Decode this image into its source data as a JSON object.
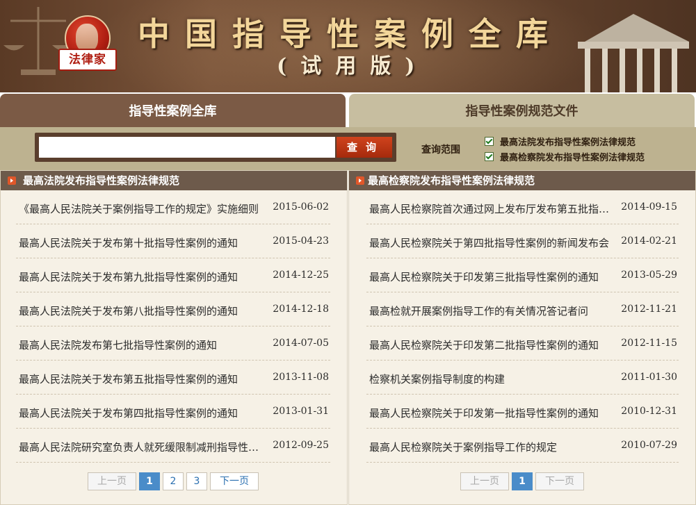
{
  "banner": {
    "logo_text": "法律家",
    "title": "中国指导性案例全库",
    "subtitle": "(试用版)"
  },
  "tabs": [
    {
      "label": "指导性案例全库",
      "active": true
    },
    {
      "label": "指导性案例规范文件",
      "active": false
    }
  ],
  "search": {
    "value": "",
    "button_label": "查询",
    "range_label": "查询范围",
    "options": [
      {
        "label": "最高法院发布指导性案例法律规范",
        "checked": true
      },
      {
        "label": "最高检察院发布指导性案例法律规范",
        "checked": true
      }
    ]
  },
  "colors": {
    "active_tab": "#7b5a45",
    "inactive_tab": "#c7bea0",
    "search_button": "#c23a17",
    "panel_header": "#6d5a4b",
    "pager_current": "#4a8cc9"
  },
  "left_panel": {
    "header": "最高法院发布指导性案例法律规范",
    "items": [
      {
        "title": "《最高人民法院关于案例指导工作的规定》实施细则",
        "date": "2015-06-02"
      },
      {
        "title": "最高人民法院关于发布第十批指导性案例的通知",
        "date": "2015-04-23"
      },
      {
        "title": "最高人民法院关于发布第九批指导性案例的通知",
        "date": "2014-12-25"
      },
      {
        "title": "最高人民法院关于发布第八批指导性案例的通知",
        "date": "2014-12-18"
      },
      {
        "title": "最高人民法院发布第七批指导性案例的通知",
        "date": "2014-07-05"
      },
      {
        "title": "最高人民法院关于发布第五批指导性案例的通知",
        "date": "2013-11-08"
      },
      {
        "title": "最高人民法院关于发布第四批指导性案例的通知",
        "date": "2013-01-31"
      },
      {
        "title": "最高人民法院研究室负责人就死缓限制减刑指导性案例答记者问",
        "date": "2012-09-25"
      }
    ],
    "pager": {
      "prev": "上一页",
      "pages": [
        "1",
        "2",
        "3"
      ],
      "current": "1",
      "next": "下一页"
    }
  },
  "right_panel": {
    "header": "最高检察院发布指导性案例法律规范",
    "items": [
      {
        "title": "最高人民检察院首次通过网上发布厅发布第五批指导性案例",
        "date": "2014-09-15"
      },
      {
        "title": "最高人民检察院关于第四批指导性案例的新闻发布会",
        "date": "2014-02-21"
      },
      {
        "title": "最高人民检察院关于印发第三批指导性案例的通知",
        "date": "2013-05-29"
      },
      {
        "title": "最高检就开展案例指导工作的有关情况答记者问",
        "date": "2012-11-21"
      },
      {
        "title": "最高人民检察院关于印发第二批指导性案例的通知",
        "date": "2012-11-15"
      },
      {
        "title": "检察机关案例指导制度的构建",
        "date": "2011-01-30"
      },
      {
        "title": "最高人民检察院关于印发第一批指导性案例的通知",
        "date": "2010-12-31"
      },
      {
        "title": "最高人民检察院关于案例指导工作的规定",
        "date": "2010-07-29"
      }
    ],
    "pager": {
      "prev": "上一页",
      "pages": [
        "1"
      ],
      "current": "1",
      "next": "下一页"
    }
  }
}
